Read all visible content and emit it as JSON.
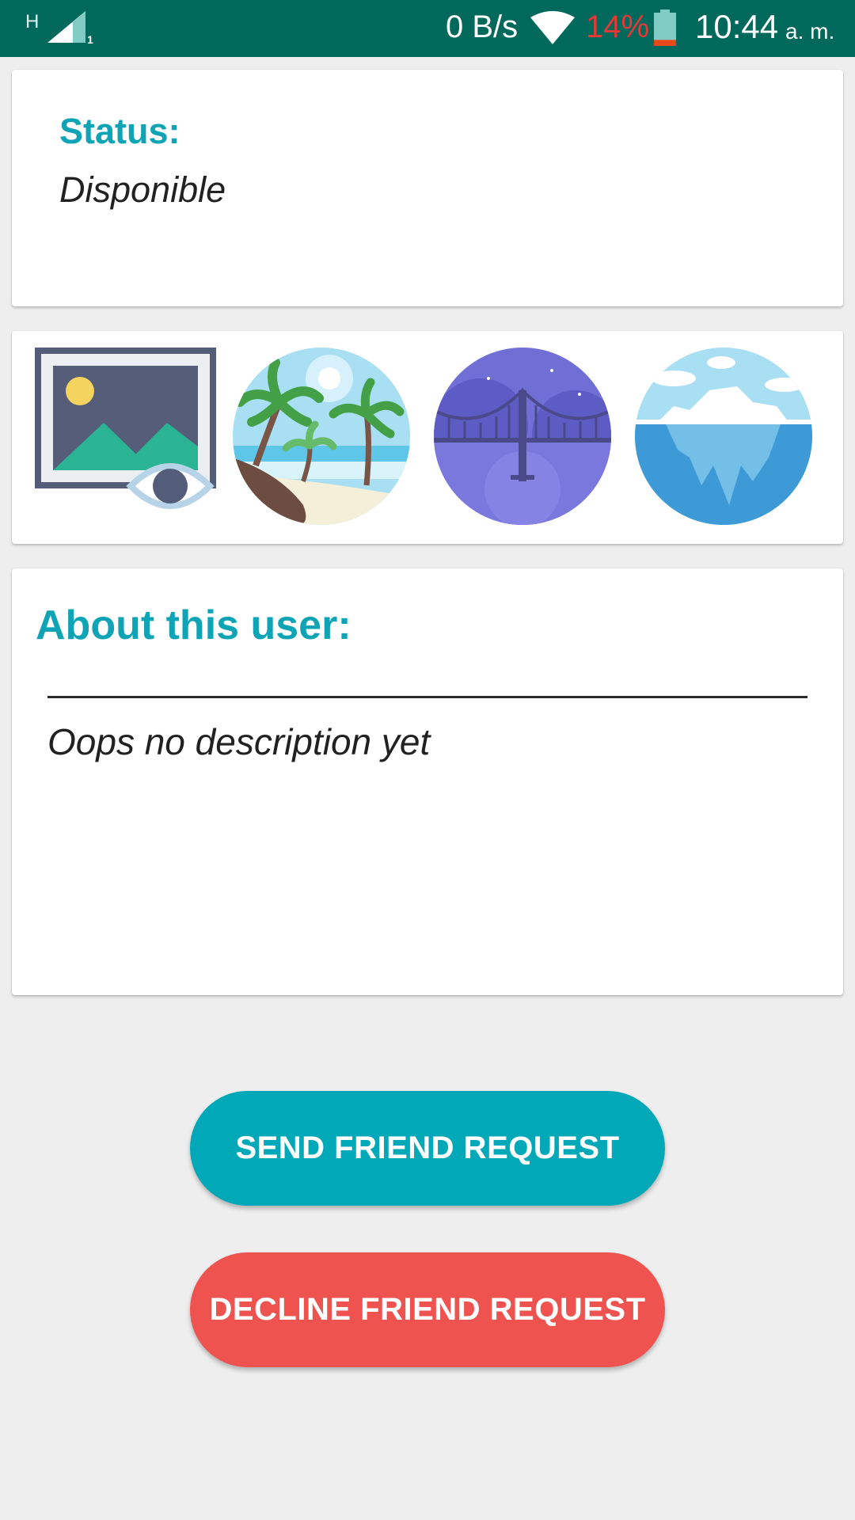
{
  "status_bar": {
    "network_type": "H",
    "sim_slot": "1",
    "data_speed": "0 B/s",
    "battery_percent": "14%",
    "battery_level": 0.14,
    "time": "10:44",
    "am_pm": "a. m.",
    "colors": {
      "background": "#00695c",
      "battery_low": "#e53935"
    }
  },
  "status_card": {
    "label": "Status:",
    "value": "Disponible"
  },
  "photos": [
    {
      "icon": "image-gallery-view-icon"
    },
    {
      "icon": "beach-palms-icon"
    },
    {
      "icon": "night-bridge-icon"
    },
    {
      "icon": "iceberg-icon"
    }
  ],
  "about_card": {
    "title": "About this user:",
    "description": "Oops no description yet"
  },
  "actions": {
    "send_label": "SEND FRIEND REQUEST",
    "decline_label": "DECLINE FRIEND REQUEST"
  },
  "colors": {
    "accent": "#0fa4b5",
    "send_button": "#00a8b8",
    "decline_button": "#ef5350",
    "page_background": "#eeeeee"
  }
}
